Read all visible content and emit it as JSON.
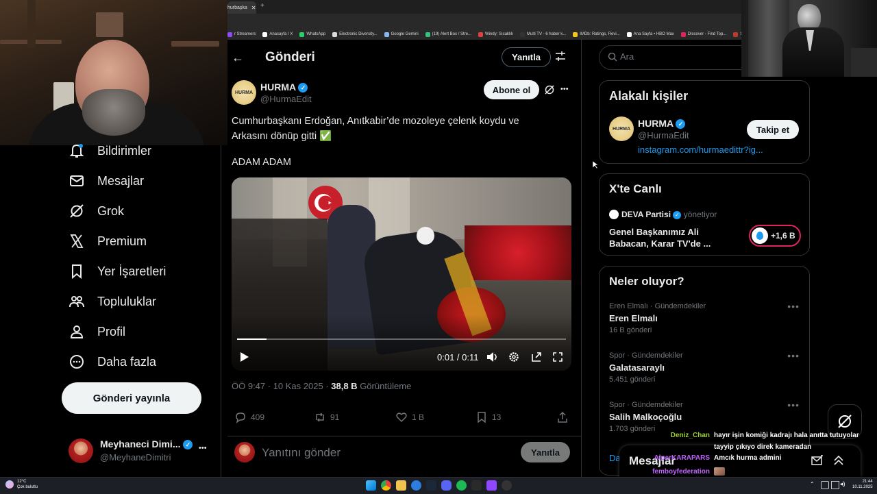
{
  "browser": {
    "tab_title": "hurbaşka",
    "tab_close": "✕",
    "new_tab": "+",
    "bookmarks": [
      {
        "label": "r Streamers",
        "color": "#9146ff"
      },
      {
        "label": "Anasayfa / X",
        "color": "#ffffff"
      },
      {
        "label": "WhatsApp",
        "color": "#25d366"
      },
      {
        "label": "Electronic Diversity...",
        "color": "#dddddd"
      },
      {
        "label": "Google Gemini",
        "color": "#8ab4f8"
      },
      {
        "label": "(19) Alert Box / Stre...",
        "color": "#31c27c"
      },
      {
        "label": "Windy: Sıcaklık",
        "color": "#e04040"
      },
      {
        "label": "Multi TV - 6 haber k...",
        "color": "#333333"
      },
      {
        "label": "IMDb: Ratings, Revi...",
        "color": "#f5c518"
      },
      {
        "label": "Ana Sayfa • HBO Max",
        "color": "#ffffff"
      },
      {
        "label": "Discover - Find Top...",
        "color": "#e0245e"
      },
      {
        "label": "SEÇİM S",
        "color": "#c0392b"
      }
    ]
  },
  "sidebar": {
    "items": [
      {
        "label": "Bildirimler",
        "icon": "bell-icon"
      },
      {
        "label": "Mesajlar",
        "icon": "envelope-icon"
      },
      {
        "label": "Grok",
        "icon": "grok-icon"
      },
      {
        "label": "Premium",
        "icon": "x-logo-icon"
      },
      {
        "label": "Yer İşaretleri",
        "icon": "bookmark-icon"
      },
      {
        "label": "Topluluklar",
        "icon": "people-icon"
      },
      {
        "label": "Profil",
        "icon": "person-icon"
      },
      {
        "label": "Daha fazla",
        "icon": "more-circle-icon"
      }
    ],
    "post_button": "Gönderi yayınla",
    "account": {
      "name": "Meyhaneci Dimi...",
      "handle": "@MeyhaneDimitri",
      "more": "•••"
    }
  },
  "header": {
    "back": "←",
    "title": "Gönderi",
    "reply_button": "Yanıtla"
  },
  "post": {
    "author_name": "HURMA",
    "author_handle": "@HurmaEdit",
    "logo_text": "HURMA",
    "subscribe_button": "Abone ol",
    "more": "•••",
    "text_line1": "Cumhurbaşkanı Erdoğan, Anıtkabir’de mozoleye çelenk koydu ve",
    "text_line2": "Arkasını dönüp gitti ✅",
    "text_line3": "ADAM ADAM",
    "video": {
      "time": "0:01 / 0:11",
      "progress": 0.09
    },
    "meta_time": "ÖÖ 9:47 · 10 Kas 2025 · ",
    "views_count": "38,8 B",
    "views_label": "Görüntüleme",
    "actions": {
      "replies": "409",
      "reposts": "91",
      "likes": "1 B",
      "bookmarks": "13"
    },
    "reply_placeholder": "Yanıtını gönder",
    "reply_submit": "Yanıtla"
  },
  "right": {
    "search_placeholder": "Ara",
    "related": {
      "title": "Alakalı kişiler",
      "name": "HURMA",
      "handle": "@HurmaEdit",
      "link": "instagram.com/hurmaedittr?ig...",
      "follow": "Takip et"
    },
    "live": {
      "title": "X'te Canlı",
      "host": "DEVA Partisi",
      "host_suffix": "yönetiyor",
      "text_line1": "Genel Başkanımız Ali",
      "text_line2": "Babacan, Karar TV'de ...",
      "listeners": "+1,6 B"
    },
    "trends": {
      "title": "Neler oluyor?",
      "items": [
        {
          "meta": "Eren Elmalı · Gündemdekiler",
          "title": "Eren Elmalı",
          "count": "16 B gönderi"
        },
        {
          "meta": "Spor · Gündemdekiler",
          "title": "Galatasaraylı",
          "count": "5.451 gönderi"
        },
        {
          "meta": "Spor · Gündemdekiler",
          "title": "Salih Malkoçoğlu",
          "count": "1.703 gönderi"
        }
      ],
      "partial": "Da"
    },
    "messages_drawer": "Mesajlar"
  },
  "chat": [
    {
      "user": "Deniz_Chan",
      "color": "#9acd32",
      "msg": "hayır işin komiği kadrajı hala anıtta tutuyolar"
    },
    {
      "user": "",
      "color": "#ffffff",
      "msg": "tayyip çıkıyo direk kameradan"
    },
    {
      "user": "AlperKARAPARS",
      "color": "#c060ff",
      "msg": "Amcık hurma admini"
    },
    {
      "user": "femboyfederation",
      "color": "#c060ff",
      "msg": ""
    },
    {
      "user": "femboyfederation",
      "color": "#c060ff",
      "msg": ""
    }
  ],
  "taskbar": {
    "weather_temp": "12°C",
    "weather_desc": "Çok bulutlu",
    "clock_time": "21:44",
    "clock_date": "10.11.2025"
  }
}
